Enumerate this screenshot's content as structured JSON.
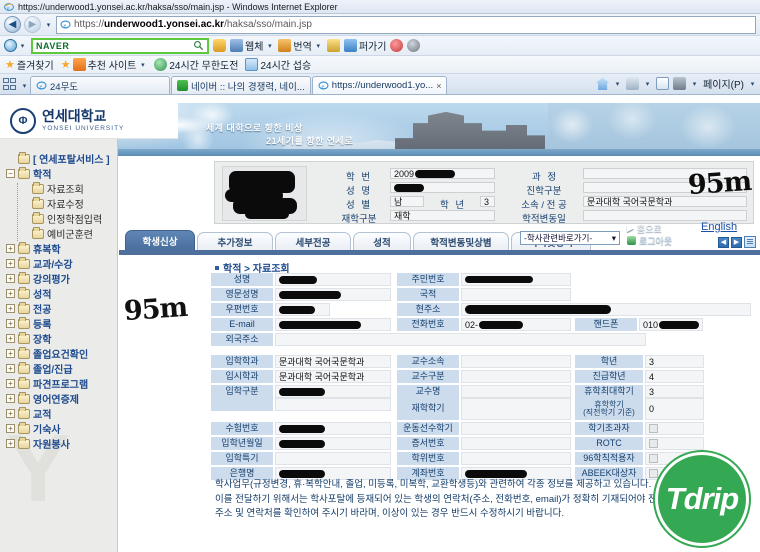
{
  "window": {
    "title": "https://underwood1.yonsei.ac.kr/haksa/sso/main.jsp - Windows Internet Explorer",
    "browser_icon": "ie-logo-icon"
  },
  "address_bar": {
    "back_label": "◀",
    "forward_label": "▶",
    "history_caret": "▾",
    "url_prefix": "https://",
    "url_host": "underwood1.yonsei.ac.kr",
    "url_path": "/haksa/sso/main.jsp",
    "favicon": "ie-page-icon"
  },
  "search_toolbar": {
    "provider": "NAVER",
    "provider_value": "",
    "search_icon": "magnifier-icon",
    "items": [
      {
        "label": "웹체",
        "icon": "capture-icon",
        "color": "#5b7fb5",
        "caret": "▾"
      },
      {
        "label": "번역",
        "icon": "translate-icon",
        "color": "#d98a2b",
        "caret": "▾"
      },
      {
        "label": "퍼가기",
        "icon": "send-icon",
        "color": "#4a90d9",
        "caret": ""
      }
    ]
  },
  "favorites_bar": {
    "favorites_label": "즐겨찾기",
    "suggested_label": "추천 사이트",
    "suggested_caret": "▾",
    "links": [
      {
        "label": "24시간 무한도전",
        "icon": "globe-icon"
      },
      {
        "label": "24시간 섭승",
        "icon": "page-icon"
      }
    ]
  },
  "tab_strip": {
    "quick_tabs_icon": "quick-tabs-icon",
    "quick_tabs_caret": "▾",
    "tabs": [
      {
        "label": "24무도",
        "icon": "ie-page-icon",
        "active": false,
        "closable": false
      },
      {
        "label": "네이버 :: 나의 경쟁력, 네이...",
        "icon": "naver-icon",
        "active": false,
        "closable": false
      },
      {
        "label": "https://underwood1.yo...",
        "icon": "ie-page-icon",
        "active": true,
        "closable": true,
        "close_label": "×"
      }
    ],
    "right_controls": [
      {
        "label": "",
        "icon": "home-icon",
        "caret": "▾"
      },
      {
        "label": "",
        "icon": "feed-icon",
        "caret": "▾"
      },
      {
        "label": "",
        "icon": "mail-icon",
        "caret": ""
      },
      {
        "label": "",
        "icon": "print-icon",
        "caret": "▾"
      },
      {
        "label": "페이지(P)",
        "icon": "",
        "caret": "▾"
      }
    ]
  },
  "banner": {
    "logo_kr": "연세대학교",
    "logo_en": "YONSEI UNIVERSITY",
    "logo_seal_icon": "yonsei-seal-icon",
    "tagline_line1": "세계 대학으로 향한 비상",
    "tagline_line2": "21세기를 향한 연세로",
    "quick_select_value": "-학사관련바로가기-",
    "quick_select_caret": "▾",
    "home_label": "홈으로",
    "home_arrow": "▶",
    "logout_label": "로그아웃",
    "logout_icon": "logout-icon",
    "english_label": "English"
  },
  "sidebar": {
    "watermark": "Y",
    "root": {
      "label": "[ 연세포탈서비스 ]",
      "icon": "folder-icon"
    },
    "items": [
      {
        "label": "학적",
        "level": 1,
        "expander": "−",
        "icon": "folder-icon"
      },
      {
        "label": "자료조회",
        "level": 2,
        "expander": "",
        "icon": "folder-icon"
      },
      {
        "label": "자료수정",
        "level": 2,
        "expander": "",
        "icon": "folder-icon"
      },
      {
        "label": "인정학점입력",
        "level": 2,
        "expander": "",
        "icon": "folder-icon"
      },
      {
        "label": "예비군훈련",
        "level": 2,
        "expander": "",
        "icon": "folder-icon"
      },
      {
        "label": "휴복학",
        "level": 1,
        "expander": "+",
        "icon": "folder-icon"
      },
      {
        "label": "교과/수강",
        "level": 1,
        "expander": "+",
        "icon": "folder-icon"
      },
      {
        "label": "강의평가",
        "level": 1,
        "expander": "+",
        "icon": "folder-icon"
      },
      {
        "label": "성적",
        "level": 1,
        "expander": "+",
        "icon": "folder-icon"
      },
      {
        "label": "전공",
        "level": 1,
        "expander": "+",
        "icon": "folder-icon"
      },
      {
        "label": "등록",
        "level": 1,
        "expander": "+",
        "icon": "folder-icon"
      },
      {
        "label": "장학",
        "level": 1,
        "expander": "+",
        "icon": "folder-icon"
      },
      {
        "label": "졸업요건확인",
        "level": 1,
        "expander": "+",
        "icon": "folder-icon"
      },
      {
        "label": "졸업/진급",
        "level": 1,
        "expander": "+",
        "icon": "folder-icon"
      },
      {
        "label": "파견프로그램",
        "level": 1,
        "expander": "+",
        "icon": "folder-icon"
      },
      {
        "label": "영어연증제",
        "level": 1,
        "expander": "+",
        "icon": "folder-icon"
      },
      {
        "label": "교적",
        "level": 1,
        "expander": "+",
        "icon": "folder-icon"
      },
      {
        "label": "기숙사",
        "level": 1,
        "expander": "+",
        "icon": "folder-icon"
      },
      {
        "label": "자원봉사",
        "level": 1,
        "expander": "+",
        "icon": "folder-icon"
      }
    ]
  },
  "student_card": {
    "photo_alt": "student-photo-redacted",
    "fields_left": [
      {
        "label": "학   번",
        "value": "2009",
        "redacted": true
      },
      {
        "label": "성   명",
        "value": "",
        "redacted": true
      },
      {
        "label": "성   별",
        "value": "남",
        "redacted": false
      },
      {
        "label": "재학구분",
        "value": "재학",
        "redacted": false
      }
    ],
    "grade_label": "학   년",
    "grade_value": "3",
    "fields_right": [
      {
        "label": "과   정",
        "value": ""
      },
      {
        "label": "진학구분",
        "value": ""
      },
      {
        "label": "소속 / 전 공",
        "value": "문과대학 국어국문학과"
      },
      {
        "label": "학적변동일",
        "value": ""
      }
    ]
  },
  "page_tabs": {
    "items": [
      {
        "label": "학생신상",
        "active": true
      },
      {
        "label": "추가정보",
        "active": false
      },
      {
        "label": "세부전공",
        "active": false
      },
      {
        "label": "성적",
        "active": false
      },
      {
        "label": "학적변동및상볌",
        "active": false
      },
      {
        "label": "학력및경력",
        "active": false
      }
    ],
    "prev_label": "◀",
    "next_label": "▶",
    "list_icon": "list-view-icon"
  },
  "breadcrumb": {
    "text": "학적 > 자료조회"
  },
  "form": {
    "row1": [
      {
        "label": "성명",
        "value": "",
        "redacted": true
      },
      {
        "label": "주민번호",
        "value": "",
        "redacted": true
      }
    ],
    "row2": [
      {
        "label": "영문성명",
        "value": "",
        "redacted": true
      },
      {
        "label": "국적",
        "value": "",
        "redacted": false
      }
    ],
    "row3": [
      {
        "label": "우편번호",
        "value": "",
        "redacted": true
      },
      {
        "label": "현주소",
        "value": "",
        "redacted": true
      }
    ],
    "row4": [
      {
        "label": "E-mail",
        "value": "",
        "redacted": true
      },
      {
        "label": "전화번호",
        "value": "02-",
        "redacted": true
      },
      {
        "label": "핸드폰",
        "value": "010",
        "redacted": true
      }
    ],
    "row5": [
      {
        "label": "외국주소",
        "value": "",
        "redacted": false
      }
    ],
    "block2": [
      {
        "l1": "입학학과",
        "v1": "문과대학 국어국문학과",
        "r1": false,
        "l2": "교수소속",
        "v2": "",
        "r2": false,
        "l3": "학년",
        "v3": "3",
        "r3": false
      },
      {
        "l1": "입시학과",
        "v1": "문과대학 국어국문학과",
        "r1": false,
        "l2": "교수구분",
        "v2": "",
        "r2": false,
        "l3": "진급학년",
        "v3": "4",
        "r3": false
      },
      {
        "l1": "입학구분",
        "v1": "",
        "r1": true,
        "l2": "교수명",
        "v2": "",
        "r2": false,
        "l3": "휴학최대학기",
        "v3": "3",
        "r3": false
      },
      {
        "l1": "",
        "v1": "",
        "r1": false,
        "l2": "재학학기",
        "v2": "",
        "r2": false,
        "l3": "휴학학기\n(직전학기 기준)",
        "v3": "0",
        "r3": false
      },
      {
        "l1": "수험번호",
        "v1": "",
        "r1": true,
        "l2": "운동선수학기",
        "v2": "",
        "r2": false,
        "l3": "학기초과자",
        "v3": "",
        "r3": false,
        "c3": true
      },
      {
        "l1": "입학년월일",
        "v1": "",
        "r1": true,
        "l2": "증서번호",
        "v2": "",
        "r2": false,
        "l3": "ROTC",
        "v3": "",
        "r3": false,
        "c3": true
      },
      {
        "l1": "입학특기",
        "v1": "",
        "r1": false,
        "l2": "학위번호",
        "v2": "",
        "r2": false,
        "l3": "96학칙적용자",
        "v3": "",
        "r3": false,
        "c3": true
      },
      {
        "l1": "은행명",
        "v1": "",
        "r1": true,
        "l2": "계좌번호",
        "v2": "",
        "r2": true,
        "l3": "ABEEK대상자",
        "v3": "",
        "r3": false,
        "c3": true
      }
    ]
  },
  "notice": {
    "line1": "학사업무(규정변경, 휴·복학안내, 졸업, 미등록, 미복학, 교환학생등)와 관련하여 각종 정보를 제공하고 있습니다.",
    "line2": "이를 전달하기 위해서는 학사포탈에 등재되어 있는 학생의 연락처(주소, 전화번호, email)가 정확히 기재되어야 전달이 가능하오니",
    "line3": "주소 및 연락처를 확인하여 주시기 바라며, 이상이 있는 경우 반드시 수정하시기 바랍니다."
  },
  "annotations": {
    "handwriting_left": "95m",
    "handwriting_right": "95m",
    "watermark_stamp": "Tdrip",
    "stamp_color": "#34a853"
  }
}
